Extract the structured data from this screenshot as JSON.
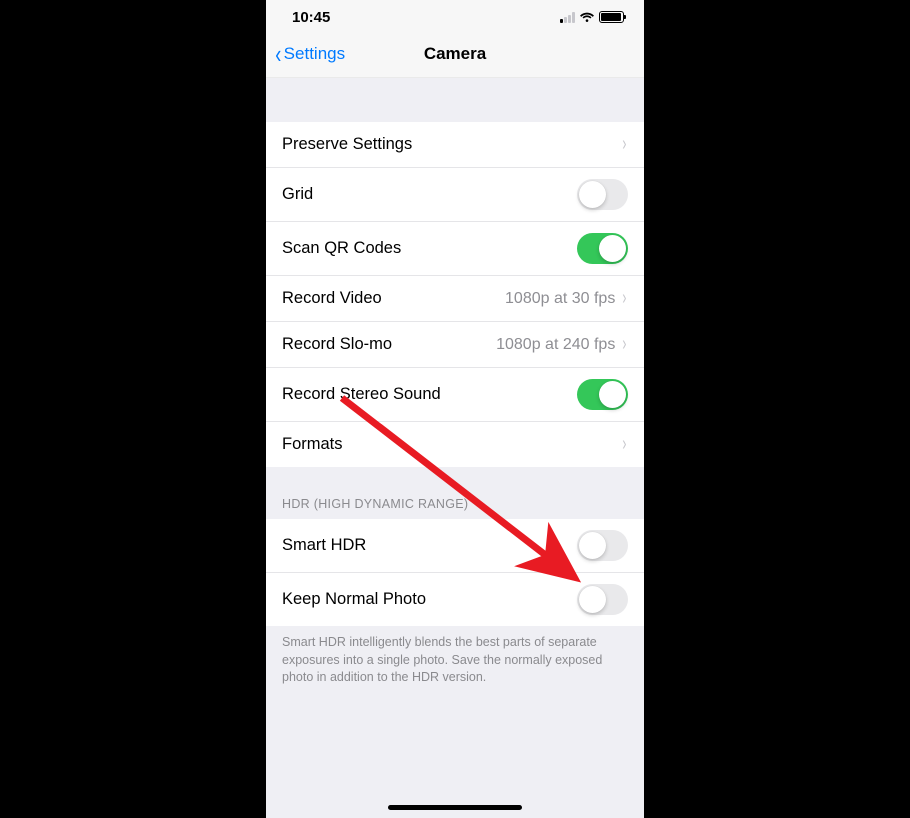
{
  "status": {
    "time": "10:45"
  },
  "nav": {
    "back_label": "Settings",
    "title": "Camera"
  },
  "rows": {
    "preserve": {
      "label": "Preserve Settings"
    },
    "grid": {
      "label": "Grid",
      "on": false
    },
    "scanqr": {
      "label": "Scan QR Codes",
      "on": true
    },
    "recvideo": {
      "label": "Record Video",
      "value": "1080p at 30 fps"
    },
    "recslomo": {
      "label": "Record Slo-mo",
      "value": "1080p at 240 fps"
    },
    "stereo": {
      "label": "Record Stereo Sound",
      "on": true
    },
    "formats": {
      "label": "Formats"
    }
  },
  "hdr": {
    "header": "HDR (HIGH DYNAMIC RANGE)",
    "smart": {
      "label": "Smart HDR",
      "on": false
    },
    "keep": {
      "label": "Keep Normal Photo",
      "on": false
    },
    "footer": "Smart HDR intelligently blends the best parts of separate exposures into a single photo. Save the normally exposed photo in addition to the HDR version."
  },
  "colors": {
    "accent": "#007aff",
    "toggle_on": "#34c759",
    "arrow": "#e81b23"
  }
}
